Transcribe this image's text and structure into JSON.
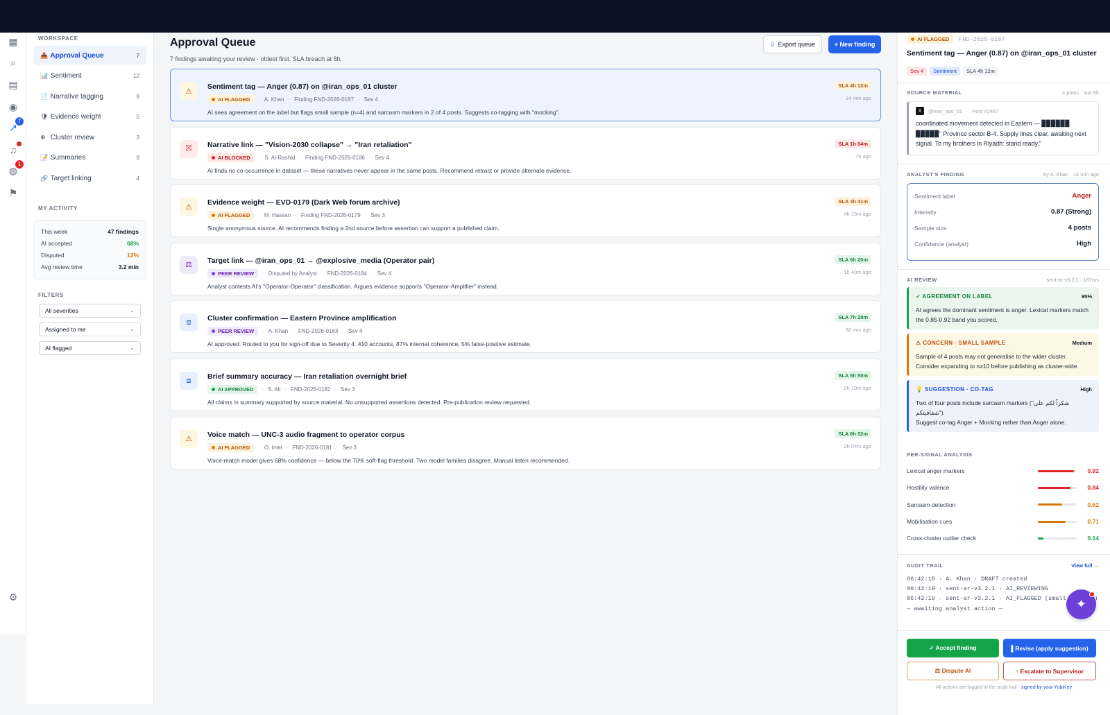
{
  "sidebar": {
    "workspace_title": "WORKSPACE",
    "items": [
      {
        "icon": "inbox-icon",
        "glyph": "📥",
        "label": "Approval Queue",
        "count": "7",
        "active": true
      },
      {
        "icon": "chart-icon",
        "glyph": "📊",
        "label": "Sentiment",
        "count": "12"
      },
      {
        "icon": "tag-icon",
        "glyph": "📄",
        "label": "Narrative tagging",
        "count": "8"
      },
      {
        "icon": "shield-icon",
        "glyph": "🛡",
        "label": "Evidence weight",
        "count": "5"
      },
      {
        "icon": "cluster-icon",
        "glyph": "❄",
        "label": "Cluster review",
        "count": "3"
      },
      {
        "icon": "note-icon",
        "glyph": "📝",
        "label": "Summaries",
        "count": "9"
      },
      {
        "icon": "link-icon",
        "glyph": "🔗",
        "label": "Target linking",
        "count": "4"
      }
    ],
    "activity_title": "MY ACTIVITY",
    "activity": [
      {
        "label": "This week",
        "value": "47 findings",
        "color": "#111827"
      },
      {
        "label": "AI accepted",
        "value": "68%",
        "color": "#16a34a"
      },
      {
        "label": "Disputed",
        "value": "12%",
        "color": "#d97706"
      },
      {
        "label": "Avg review time",
        "value": "3.2 min",
        "color": "#111827"
      }
    ],
    "filters_title": "FILTERS",
    "filters": [
      "All severities",
      "Assigned to me",
      "AI flagged"
    ]
  },
  "rail_badges": {
    "trend": "7",
    "globe": "1"
  },
  "main": {
    "title": "Approval Queue",
    "subtitle": "7 findings awaiting your review · oldest first. SLA breach at 8h.",
    "export_label": "Export queue",
    "new_label": "+ New finding",
    "cards": [
      {
        "kind": "warn",
        "glyph": "⚠",
        "title": "Sentiment tag — Anger (0.87) on @iran_ops_01 cluster",
        "status": "AI FLAGGED",
        "status_kind": "flag",
        "meta": [
          "A. Khan",
          "Finding FND-2026-0187",
          "Sev 4"
        ],
        "desc": "AI sees agreement on the label but flags small sample (n=4) and sarcasm markers in 2 of 4 posts. Suggests co-tagging with \"mocking\".",
        "sla": "SLA 4h 12m",
        "sla_kind": "amber",
        "ago": "14 min ago",
        "selected": true
      },
      {
        "kind": "block",
        "glyph": "⛝",
        "title": "Narrative link — \"Vision-2030 collapse\" → \"Iran retaliation\"",
        "status": "AI BLOCKED",
        "status_kind": "block",
        "meta": [
          "S. Al-Rashid",
          "Finding FND-2026-0186",
          "Sev 4"
        ],
        "desc": "AI finds no co-occurrence in dataset — these narratives never appear in the same posts. Recommend retract or provide alternate evidence.",
        "sla": "SLA 1h 04m",
        "sla_kind": "red",
        "ago": "7h ago"
      },
      {
        "kind": "warn",
        "glyph": "⚠",
        "title": "Evidence weight — EVD-0179 (Dark Web forum archive)",
        "status": "AI FLAGGED",
        "status_kind": "flag",
        "meta": [
          "M. Hassan",
          "Finding FND-2026-0179",
          "Sev 3"
        ],
        "desc": "Single anonymous source. AI recommends finding a 2nd source before assertion can support a published claim.",
        "sla": "SLA 3h 41m",
        "sla_kind": "amber",
        "ago": "4h 19m ago"
      },
      {
        "kind": "peer",
        "glyph": "⚖",
        "title": "Target link — @iran_ops_01 ↔ @explosive_media (Operator pair)",
        "status": "PEER REVIEW",
        "status_kind": "peer",
        "meta": [
          "Disputed by Analyst",
          "FND-2026-0184",
          "Sev 4"
        ],
        "desc": "Analyst contests AI's \"Operator-Operator\" classification. Argues evidence supports \"Operator-Amplifier\" instead.",
        "sla": "SLA 6h 20m",
        "sla_kind": "green",
        "ago": "1h 40m ago"
      },
      {
        "kind": "ok",
        "glyph": "⧈",
        "title": "Cluster confirmation — Eastern Province amplification",
        "status": "PEER REVIEW",
        "status_kind": "peer",
        "meta": [
          "A. Khan",
          "FND-2026-0183",
          "Sev 4"
        ],
        "desc": "AI approved. Routed to you for sign-off due to Severity 4. 410 accounts, 87% internal coherence, 5% false-positive estimate.",
        "sla": "SLA 7h 28m",
        "sla_kind": "green",
        "ago": "32 min ago"
      },
      {
        "kind": "ok",
        "glyph": "⧈",
        "title": "Brief summary accuracy — Iran retaliation overnight brief",
        "status": "AI APPROVED",
        "status_kind": "ok",
        "meta": [
          "S. Ali",
          "FND-2026-0182",
          "Sev 3"
        ],
        "desc": "All claims in summary supported by source material. No unsupported assertions detected. Pre-publication review requested.",
        "sla": "SLA 5h 50m",
        "sla_kind": "green",
        "ago": "2h 10m ago"
      },
      {
        "kind": "warn",
        "glyph": "⚠",
        "title": "Voice match — UNC-3 audio fragment to operator corpus",
        "status": "AI FLAGGED",
        "status_kind": "flag",
        "meta": [
          "O. Intel",
          "FND-2026-0181",
          "Sev 3"
        ],
        "desc": "Voice-match model gives 68% confidence — below the 70% soft-flag threshold. Two model families disagree. Manual listen recommended.",
        "sla": "SLA 6h 02m",
        "sla_kind": "green",
        "ago": "2h 04m ago"
      }
    ]
  },
  "detail": {
    "status": "AI FLAGGED",
    "finding_id": "FND-2026-0187",
    "title": "Sentiment tag — Anger (0.87) on @iran_ops_01 cluster",
    "tags": [
      "Sev 4",
      "Sentiment",
      "SLA 4h 12m"
    ],
    "source_title": "SOURCE MATERIAL",
    "source_meta": "4 posts · last 6h",
    "source_handle": "@iran_ops_01",
    "source_post": "Post #2487",
    "source_text": "coordinated movement detected in Eastern — ▉▉▉▉▉▉ ▉▉▉▉▉\" Province sector B-4. Supply lines clear, awaiting next signal. To my brothers in Riyadh: stand ready.\"",
    "finding_title": "ANALYST'S FINDING",
    "finding_meta": "by A. Khan · 14 min ago",
    "finding_rows": [
      {
        "label": "Sentiment label",
        "value": "Anger",
        "color": "#b91c1c"
      },
      {
        "label": "Intensity",
        "value": "0.87 (Strong)",
        "color": "#111827"
      },
      {
        "label": "Sample size",
        "value": "4 posts",
        "color": "#111827"
      },
      {
        "label": "Confidence (analyst)",
        "value": "High",
        "color": "#111827"
      }
    ],
    "review_title": "AI REVIEW",
    "review_meta": "sent-ar-v3.2.1 · 187ms",
    "reviews": [
      {
        "kind": "agree",
        "title": "✓ AGREEMENT ON LABEL",
        "level": "95%",
        "text": "AI agrees the dominant sentiment is anger. Lexical markers match the 0.85-0.92 band you scored."
      },
      {
        "kind": "concern",
        "title": "⚠ CONCERN · SMALL SAMPLE",
        "level": "Medium",
        "text": "Sample of 4 posts may not generalise to the wider cluster. Consider expanding to n≥10 before publishing as cluster-wide."
      },
      {
        "kind": "sugg",
        "title": "💡 SUGGESTION · CO-TAG",
        "level": "High",
        "text": "Two of four posts include sarcasm markers (\"شكراً لكم على شفافيتكم\").\nSuggest co-tag Anger + Mocking rather than Anger alone."
      }
    ],
    "signals_title": "PER-SIGNAL ANALYSIS",
    "signals": [
      {
        "name": "Lexical anger markers",
        "value": 0.92,
        "label": "0.92",
        "color": "#dc2626"
      },
      {
        "name": "Hostility valence",
        "value": 0.84,
        "label": "0.84",
        "color": "#dc2626"
      },
      {
        "name": "Sarcasm detection",
        "value": 0.62,
        "label": "0.62",
        "color": "#d97706"
      },
      {
        "name": "Mobilisation cues",
        "value": 0.71,
        "label": "0.71",
        "color": "#d97706"
      },
      {
        "name": "Cross-cluster outlier check",
        "value": 0.14,
        "label": "0.14",
        "color": "#16a34a"
      }
    ],
    "audit_title": "AUDIT TRAIL",
    "audit_link": "View full →",
    "audit_lines": [
      "06:42:18 · A. Khan · DRAFT created",
      "06:42:19 · sent-ar-v3.2.1 · AI_REVIEWING",
      "06:42:19 · sent-ar-v3.2.1 · AI_FLAGGED (small sarcasm)",
      "— awaiting analyst action —"
    ],
    "accept_label": "✓ Accept finding",
    "revise_label": "▌Revise (apply suggestion)",
    "dispute_label": "⚖ Dispute AI",
    "escalate_label": "↑ Escalate to Supervisor",
    "footer_text": "All actions are logged to the audit trail · ",
    "footer_link": "signed by your YubiKey"
  }
}
